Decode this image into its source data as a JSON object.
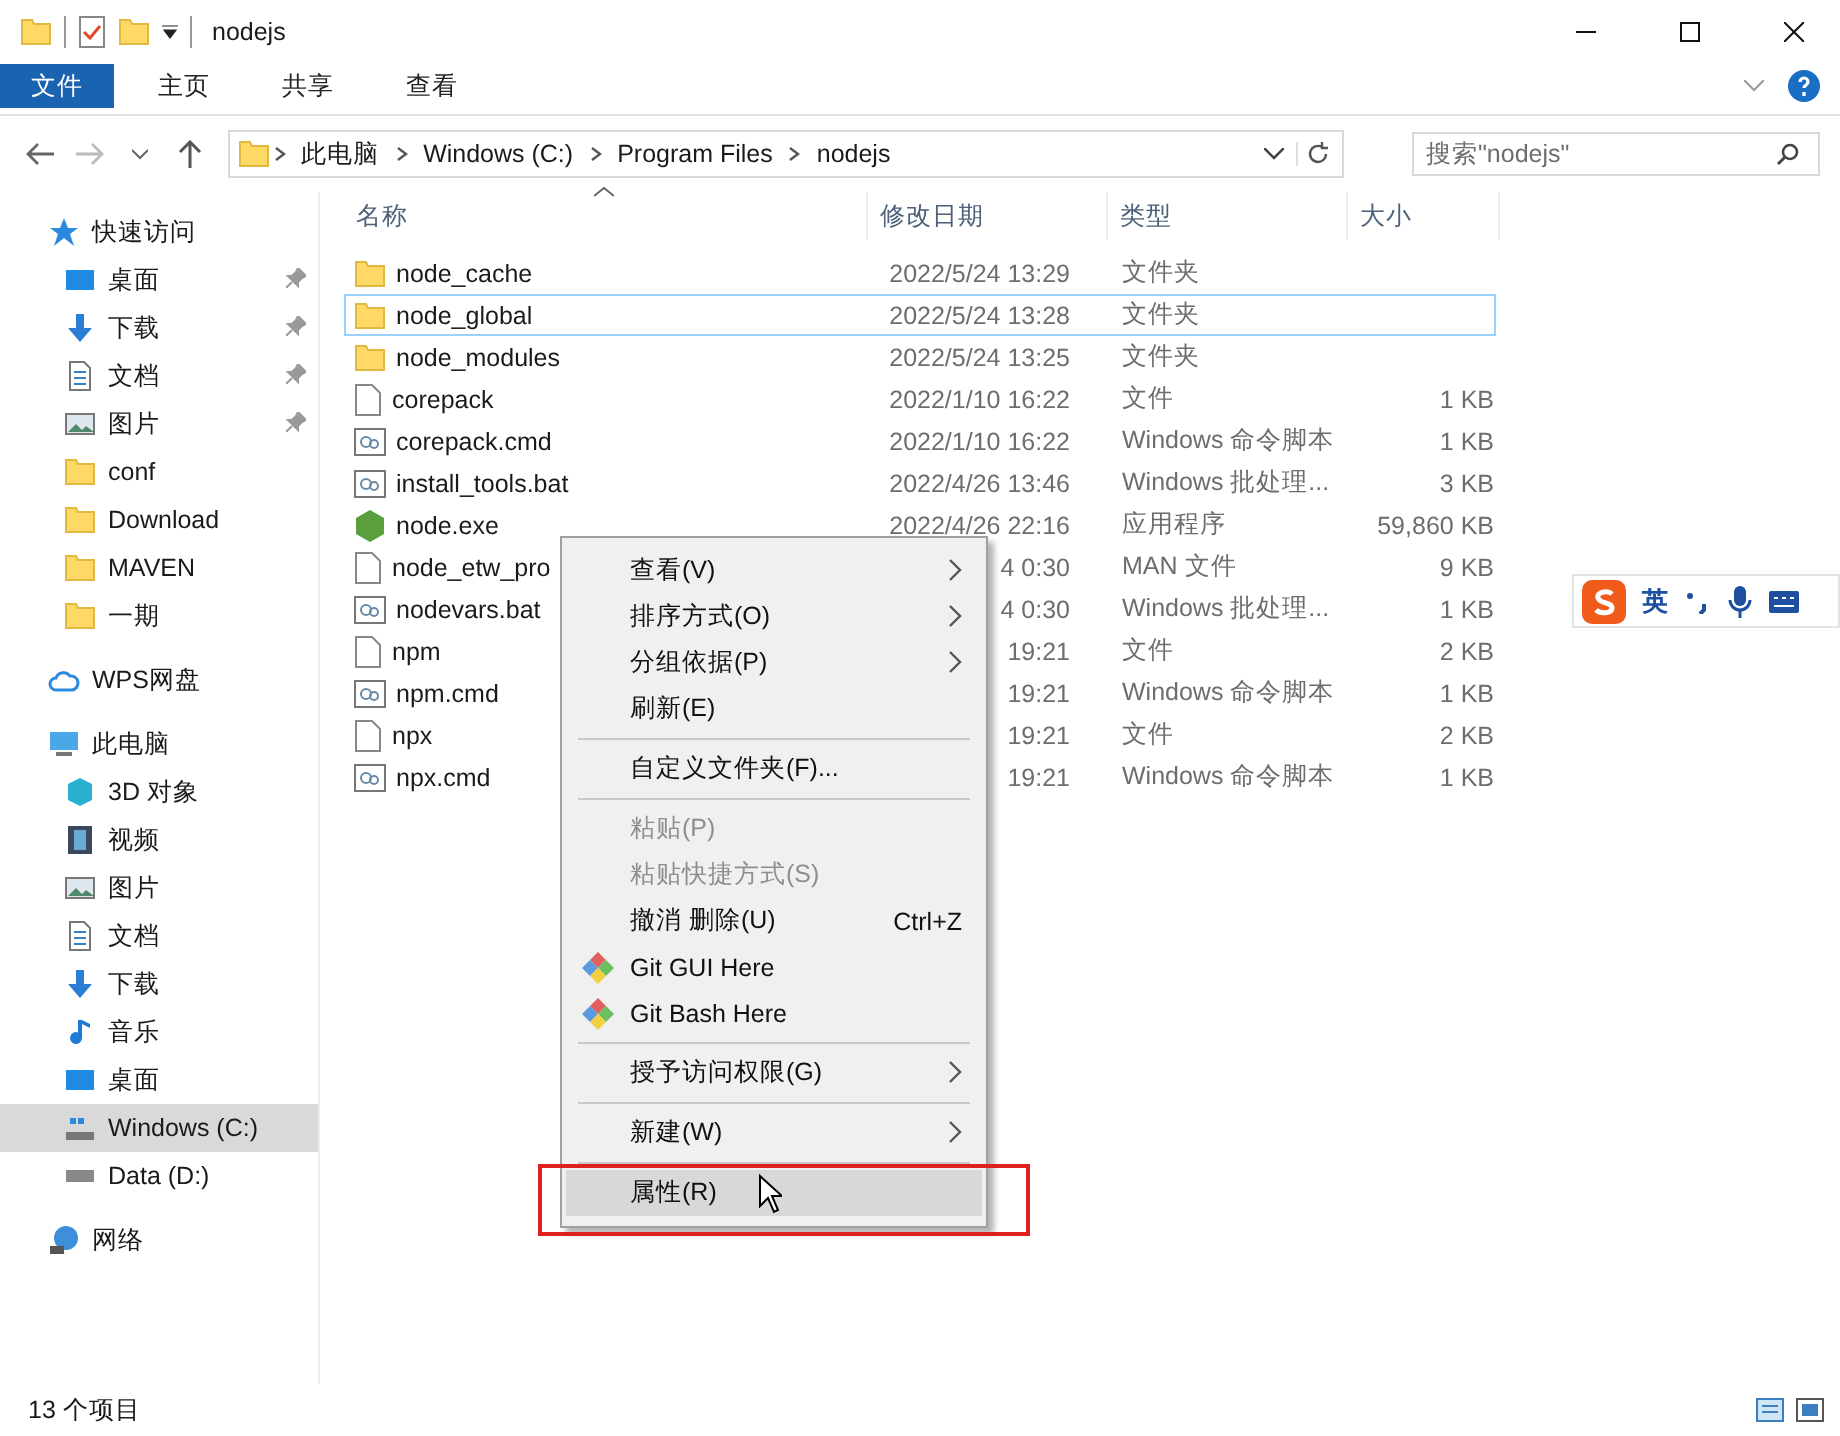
{
  "window": {
    "title": "nodejs"
  },
  "ribbon_tabs": [
    {
      "label": "文件",
      "selected": true
    },
    {
      "label": "主页",
      "selected": false
    },
    {
      "label": "共享",
      "selected": false
    },
    {
      "label": "查看",
      "selected": false
    }
  ],
  "address": {
    "crumbs": [
      "此电脑",
      "Windows (C:)",
      "Program Files",
      "nodejs"
    ]
  },
  "search": {
    "placeholder": "搜索\"nodejs\""
  },
  "sidebar": [
    {
      "label": "快速访问",
      "kind": "star",
      "selected": false,
      "children": [
        {
          "label": "桌面",
          "kind": "desktop",
          "pinned": true,
          "selected": false
        },
        {
          "label": "下载",
          "kind": "download",
          "pinned": true,
          "selected": false
        },
        {
          "label": "文档",
          "kind": "document",
          "pinned": true,
          "selected": false
        },
        {
          "label": "图片",
          "kind": "pictures",
          "pinned": true,
          "selected": false
        },
        {
          "label": "conf",
          "kind": "folder",
          "pinned": false,
          "selected": false
        },
        {
          "label": "Download",
          "kind": "folder",
          "pinned": false,
          "selected": false
        },
        {
          "label": "MAVEN",
          "kind": "folder",
          "pinned": false,
          "selected": false
        },
        {
          "label": "一期",
          "kind": "folder",
          "pinned": false,
          "selected": false
        }
      ]
    },
    {
      "label": "WPS网盘",
      "kind": "cloud",
      "selected": false
    },
    {
      "label": "此电脑",
      "kind": "computer",
      "selected": false,
      "children": [
        {
          "label": "3D 对象",
          "kind": "cube",
          "pinned": false,
          "selected": false
        },
        {
          "label": "视频",
          "kind": "video",
          "pinned": false,
          "selected": false
        },
        {
          "label": "图片",
          "kind": "pictures",
          "pinned": false,
          "selected": false
        },
        {
          "label": "文档",
          "kind": "document",
          "pinned": false,
          "selected": false
        },
        {
          "label": "下载",
          "kind": "download",
          "pinned": false,
          "selected": false
        },
        {
          "label": "音乐",
          "kind": "music",
          "pinned": false,
          "selected": false
        },
        {
          "label": "桌面",
          "kind": "desktop",
          "pinned": false,
          "selected": false
        },
        {
          "label": "Windows (C:)",
          "kind": "windrive",
          "pinned": false,
          "selected": true
        },
        {
          "label": "Data (D:)",
          "kind": "drive",
          "pinned": false,
          "selected": false
        }
      ]
    },
    {
      "label": "网络",
      "kind": "network",
      "selected": false
    }
  ],
  "table": {
    "columns": [
      "名称",
      "修改日期",
      "类型",
      "大小"
    ],
    "rows": [
      {
        "kind": "folder",
        "name": "node_cache",
        "date": "2022/5/24 13:29",
        "type": "文件夹",
        "focused": false
      },
      {
        "kind": "folder",
        "name": "node_global",
        "date": "2022/5/24 13:28",
        "type": "文件夹",
        "focused": true
      },
      {
        "kind": "folder",
        "name": "node_modules",
        "date": "2022/5/24 13:25",
        "type": "文件夹",
        "focused": false
      },
      {
        "kind": "file",
        "name": "corepack",
        "date": "2022/1/10 16:22",
        "type": "文件",
        "size": "1 KB",
        "focused": false
      },
      {
        "kind": "script",
        "name": "corepack.cmd",
        "date": "2022/1/10 16:22",
        "type": "Windows 命令脚本",
        "size": "1 KB",
        "focused": false
      },
      {
        "kind": "script",
        "name": "install_tools.bat",
        "date": "2022/4/26 13:46",
        "type": "Windows 批处理...",
        "size": "3 KB",
        "focused": false
      },
      {
        "kind": "app",
        "name": "node.exe",
        "date": "2022/4/26 22:16",
        "type": "应用程序",
        "size": "59,860 KB",
        "focused": false
      },
      {
        "kind": "file",
        "name": "node_etw_pro",
        "date": "4 0:30",
        "type": "MAN 文件",
        "size": "9 KB",
        "focused": false
      },
      {
        "kind": "script",
        "name": "nodevars.bat",
        "date": "4 0:30",
        "type": "Windows 批处理...",
        "size": "1 KB",
        "focused": false
      },
      {
        "kind": "file",
        "name": "npm",
        "date": "19:21",
        "type": "文件",
        "size": "2 KB",
        "focused": false
      },
      {
        "kind": "script",
        "name": "npm.cmd",
        "date": "19:21",
        "type": "Windows 命令脚本",
        "size": "1 KB",
        "focused": false
      },
      {
        "kind": "file",
        "name": "npx",
        "date": "19:21",
        "type": "文件",
        "size": "2 KB",
        "focused": false
      },
      {
        "kind": "script",
        "name": "npx.cmd",
        "date": "19:21",
        "type": "Windows 命令脚本",
        "size": "1 KB",
        "focused": false
      }
    ]
  },
  "context_menu": [
    {
      "kind": "item",
      "label": "查看(V)",
      "submenu": true,
      "disabled": false,
      "selected": false
    },
    {
      "kind": "item",
      "label": "排序方式(O)",
      "submenu": true,
      "disabled": false,
      "selected": false
    },
    {
      "kind": "item",
      "label": "分组依据(P)",
      "submenu": true,
      "disabled": false,
      "selected": false
    },
    {
      "kind": "item",
      "label": "刷新(E)",
      "submenu": false,
      "disabled": false,
      "selected": false
    },
    {
      "kind": "separator"
    },
    {
      "kind": "item",
      "label": "自定义文件夹(F)...",
      "submenu": false,
      "disabled": false,
      "selected": false
    },
    {
      "kind": "separator"
    },
    {
      "kind": "item",
      "label": "粘贴(P)",
      "submenu": false,
      "disabled": true,
      "selected": false
    },
    {
      "kind": "item",
      "label": "粘贴快捷方式(S)",
      "submenu": false,
      "disabled": true,
      "selected": false
    },
    {
      "kind": "item",
      "label": "撤消 删除(U)",
      "shortcut": "Ctrl+Z",
      "submenu": false,
      "disabled": false,
      "selected": false
    },
    {
      "kind": "git",
      "label": "Git GUI Here",
      "submenu": false,
      "disabled": false,
      "selected": false
    },
    {
      "kind": "git",
      "label": "Git Bash Here",
      "submenu": false,
      "disabled": false,
      "selected": false
    },
    {
      "kind": "separator"
    },
    {
      "kind": "item",
      "label": "授予访问权限(G)",
      "submenu": true,
      "disabled": false,
      "selected": false
    },
    {
      "kind": "separator"
    },
    {
      "kind": "item",
      "label": "新建(W)",
      "submenu": true,
      "disabled": false,
      "selected": false
    },
    {
      "kind": "separator"
    },
    {
      "kind": "item",
      "label": "属性(R)",
      "submenu": false,
      "disabled": false,
      "selected": true,
      "highlighted": true
    }
  ],
  "ime": {
    "mode": "英"
  },
  "status_bar": {
    "count": "13 个项目"
  }
}
